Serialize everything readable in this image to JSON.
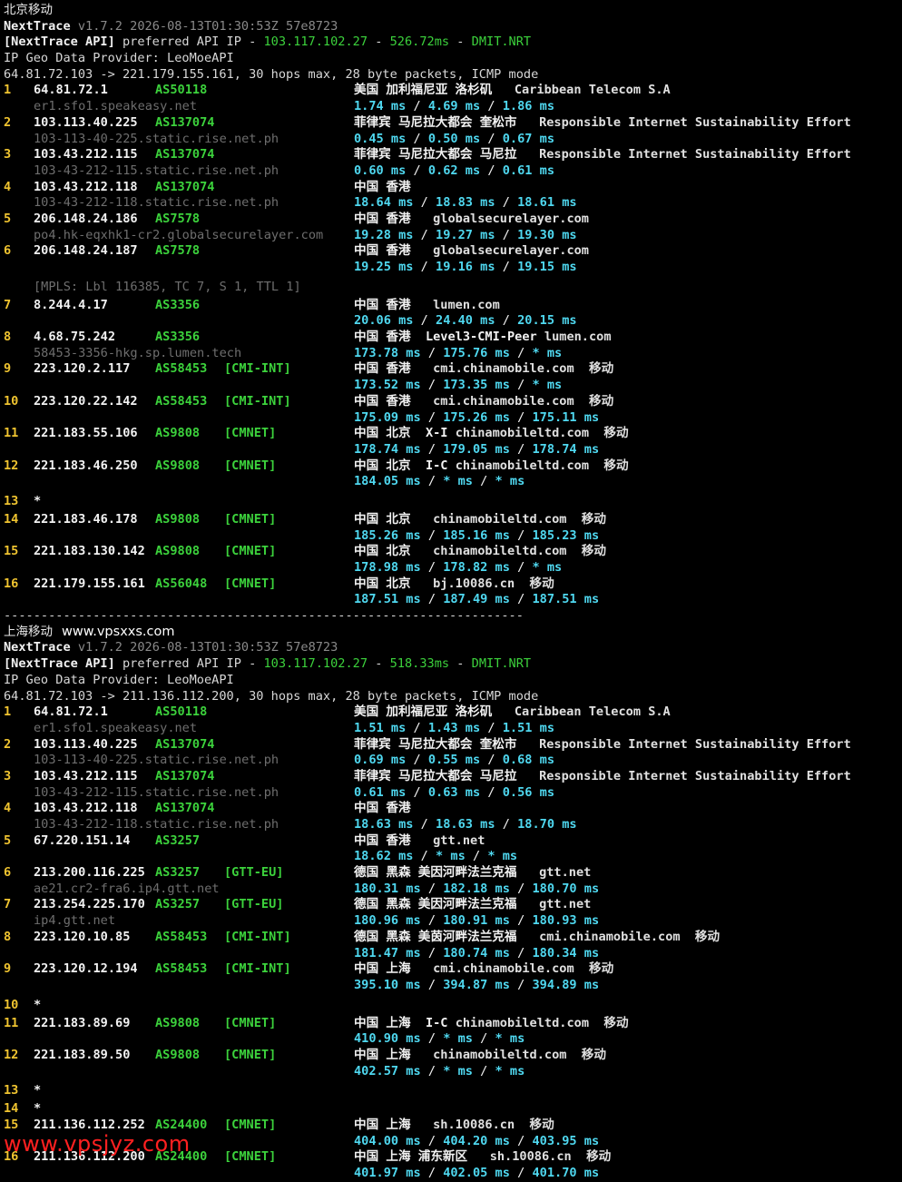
{
  "watermark": "www.vpsjyz.com",
  "separator": "----------------------------------------------------------------------",
  "sections": [
    {
      "title": "北京移动",
      "site": "",
      "brand": "NextTrace",
      "version": " v1.7.2 2026-08-13T01:30:53Z 57e8723",
      "api_prefix": "[NextTrace API]",
      "api_text": " preferred API IP - ",
      "api_ip": "103.117.102.27",
      "api_sep": " - ",
      "api_latency": "526.72ms",
      "api_sep2": " - ",
      "api_node": "DMIT.NRT",
      "geo_provider": "IP Geo Data Provider: LeoMoeAPI",
      "trace_header": "64.81.72.103 -> 221.179.155.161, 30 hops max, 28 byte packets, ICMP mode",
      "hops": [
        {
          "n": "1",
          "ip": "64.81.72.1",
          "as": "AS50118",
          "tag": "",
          "geo": "美国 加利福尼亚 洛杉矶",
          "tag2": "",
          "org": "Caribbean Telecom S.A",
          "host": "er1.sfo1.speakeasy.net",
          "rtt": [
            "1.74 ms",
            "4.69 ms",
            "1.86 ms"
          ]
        },
        {
          "n": "2",
          "ip": "103.113.40.225",
          "as": "AS137074",
          "tag": "",
          "geo": "菲律宾 马尼拉大都会 奎松市",
          "tag2": "",
          "org": "Responsible Internet Sustainability Effort",
          "host": "103-113-40-225.static.rise.net.ph",
          "rtt": [
            "0.45 ms",
            "0.50 ms",
            "0.67 ms"
          ]
        },
        {
          "n": "3",
          "ip": "103.43.212.115",
          "as": "AS137074",
          "tag": "",
          "geo": "菲律宾 马尼拉大都会 马尼拉",
          "tag2": "",
          "org": "Responsible Internet Sustainability Effort",
          "host": "103-43-212-115.static.rise.net.ph",
          "rtt": [
            "0.60 ms",
            "0.62 ms",
            "0.61 ms"
          ]
        },
        {
          "n": "4",
          "ip": "103.43.212.118",
          "as": "AS137074",
          "tag": "",
          "geo": "中国 香港",
          "tag2": "",
          "org": "",
          "host": "103-43-212-118.static.rise.net.ph",
          "rtt": [
            "18.64 ms",
            "18.83 ms",
            "18.61 ms"
          ]
        },
        {
          "n": "5",
          "ip": "206.148.24.186",
          "as": "AS7578",
          "tag": "",
          "geo": "中国 香港",
          "tag2": "",
          "org": "globalsecurelayer.com",
          "host": "po4.hk-eqxhk1-cr2.globalsecurelayer.com",
          "rtt": [
            "19.28 ms",
            "19.27 ms",
            "19.30 ms"
          ]
        },
        {
          "n": "6",
          "ip": "206.148.24.187",
          "as": "AS7578",
          "tag": "",
          "geo": "中国 香港",
          "tag2": "",
          "org": "globalsecurelayer.com",
          "host": "",
          "rtt": [
            "19.25 ms",
            "19.16 ms",
            "19.15 ms"
          ],
          "mpls": "[MPLS: Lbl 116385, TC 7, S 1, TTL 1]"
        },
        {
          "n": "7",
          "ip": "8.244.4.17",
          "as": "AS3356",
          "tag": "",
          "geo": "中国 香港",
          "tag2": "",
          "org": "lumen.com",
          "host": "",
          "rtt": [
            "20.06 ms",
            "24.40 ms",
            "20.15 ms"
          ]
        },
        {
          "n": "8",
          "ip": "4.68.75.242",
          "as": "AS3356",
          "tag": "",
          "geo": "中国 香港",
          "tag2": "Level3-CMI-Peer",
          "org": "lumen.com",
          "host": "58453-3356-hkg.sp.lumen.tech",
          "rtt": [
            "173.78 ms",
            "175.76 ms",
            "* ms"
          ]
        },
        {
          "n": "9",
          "ip": "223.120.2.117",
          "as": "AS58453",
          "tag": "[CMI-INT]",
          "geo": "中国 香港",
          "tag2": "",
          "org": "cmi.chinamobile.com  移动",
          "host": "",
          "rtt": [
            "173.52 ms",
            "173.35 ms",
            "* ms"
          ]
        },
        {
          "n": "10",
          "ip": "223.120.22.142",
          "as": "AS58453",
          "tag": "[CMI-INT]",
          "geo": "中国 香港",
          "tag2": "",
          "org": "cmi.chinamobile.com  移动",
          "host": "",
          "rtt": [
            "175.09 ms",
            "175.26 ms",
            "175.11 ms"
          ]
        },
        {
          "n": "11",
          "ip": "221.183.55.106",
          "as": "AS9808",
          "tag": "[CMNET]",
          "geo": "中国 北京",
          "tag2": "X-I",
          "org": "chinamobileltd.com  移动",
          "host": "",
          "rtt": [
            "178.74 ms",
            "179.05 ms",
            "178.74 ms"
          ]
        },
        {
          "n": "12",
          "ip": "221.183.46.250",
          "as": "AS9808",
          "tag": "[CMNET]",
          "geo": "中国 北京",
          "tag2": "I-C",
          "org": "chinamobileltd.com  移动",
          "host": "",
          "rtt": [
            "184.05 ms",
            "* ms",
            "* ms"
          ]
        },
        {
          "n": "13",
          "ip": "*",
          "timeout": true
        },
        {
          "n": "14",
          "ip": "221.183.46.178",
          "as": "AS9808",
          "tag": "[CMNET]",
          "geo": "中国 北京",
          "tag2": "",
          "org": "chinamobileltd.com  移动",
          "host": "",
          "rtt": [
            "185.26 ms",
            "185.16 ms",
            "185.23 ms"
          ]
        },
        {
          "n": "15",
          "ip": "221.183.130.142",
          "as": "AS9808",
          "tag": "[CMNET]",
          "geo": "中国 北京",
          "tag2": "",
          "org": "chinamobileltd.com  移动",
          "host": "",
          "rtt": [
            "178.98 ms",
            "178.82 ms",
            "* ms"
          ]
        },
        {
          "n": "16",
          "ip": "221.179.155.161",
          "as": "AS56048",
          "tag": "[CMNET]",
          "geo": "中国 北京",
          "tag2": "",
          "org": "bj.10086.cn  移动",
          "host": "",
          "rtt": [
            "187.51 ms",
            "187.49 ms",
            "187.51 ms"
          ]
        }
      ]
    },
    {
      "title": "上海移动",
      "site": "www.vpsxxs.com",
      "brand": "NextTrace",
      "version": " v1.7.2 2026-08-13T01:30:53Z 57e8723",
      "api_prefix": "[NextTrace API]",
      "api_text": " preferred API IP - ",
      "api_ip": "103.117.102.27",
      "api_sep": " - ",
      "api_latency": "518.33ms",
      "api_sep2": " - ",
      "api_node": "DMIT.NRT",
      "geo_provider": "IP Geo Data Provider: LeoMoeAPI",
      "trace_header": "64.81.72.103 -> 211.136.112.200, 30 hops max, 28 byte packets, ICMP mode",
      "hops": [
        {
          "n": "1",
          "ip": "64.81.72.1",
          "as": "AS50118",
          "tag": "",
          "geo": "美国 加利福尼亚 洛杉矶",
          "tag2": "",
          "org": "Caribbean Telecom S.A",
          "host": "er1.sfo1.speakeasy.net",
          "rtt": [
            "1.51 ms",
            "1.43 ms",
            "1.51 ms"
          ]
        },
        {
          "n": "2",
          "ip": "103.113.40.225",
          "as": "AS137074",
          "tag": "",
          "geo": "菲律宾 马尼拉大都会 奎松市",
          "tag2": "",
          "org": "Responsible Internet Sustainability Effort",
          "host": "103-113-40-225.static.rise.net.ph",
          "rtt": [
            "0.69 ms",
            "0.55 ms",
            "0.68 ms"
          ]
        },
        {
          "n": "3",
          "ip": "103.43.212.115",
          "as": "AS137074",
          "tag": "",
          "geo": "菲律宾 马尼拉大都会 马尼拉",
          "tag2": "",
          "org": "Responsible Internet Sustainability Effort",
          "host": "103-43-212-115.static.rise.net.ph",
          "rtt": [
            "0.61 ms",
            "0.63 ms",
            "0.56 ms"
          ]
        },
        {
          "n": "4",
          "ip": "103.43.212.118",
          "as": "AS137074",
          "tag": "",
          "geo": "中国 香港",
          "tag2": "",
          "org": "",
          "host": "103-43-212-118.static.rise.net.ph",
          "rtt": [
            "18.63 ms",
            "18.63 ms",
            "18.70 ms"
          ]
        },
        {
          "n": "5",
          "ip": "67.220.151.14",
          "as": "AS3257",
          "tag": "",
          "geo": "中国 香港",
          "tag2": "",
          "org": "gtt.net",
          "host": "",
          "rtt": [
            "18.62 ms",
            "* ms",
            "* ms"
          ]
        },
        {
          "n": "6",
          "ip": "213.200.116.225",
          "as": "AS3257",
          "tag": "[GTT-EU]",
          "geo": "德国 黑森 美因河畔法兰克福",
          "tag2": "",
          "org": "gtt.net",
          "host": "ae21.cr2-fra6.ip4.gtt.net",
          "rtt": [
            "180.31 ms",
            "182.18 ms",
            "180.70 ms"
          ]
        },
        {
          "n": "7",
          "ip": "213.254.225.170",
          "as": "AS3257",
          "tag": "[GTT-EU]",
          "geo": "德国 黑森 美因河畔法兰克福",
          "tag2": "",
          "org": "gtt.net",
          "host": "ip4.gtt.net",
          "rtt": [
            "180.96 ms",
            "180.91 ms",
            "180.93 ms"
          ]
        },
        {
          "n": "8",
          "ip": "223.120.10.85",
          "as": "AS58453",
          "tag": "[CMI-INT]",
          "geo": "德国 黑森 美茵河畔法兰克福",
          "tag2": "",
          "org": "cmi.chinamobile.com  移动",
          "host": "",
          "rtt": [
            "181.47 ms",
            "180.74 ms",
            "180.34 ms"
          ]
        },
        {
          "n": "9",
          "ip": "223.120.12.194",
          "as": "AS58453",
          "tag": "[CMI-INT]",
          "geo": "中国 上海",
          "tag2": "",
          "org": "cmi.chinamobile.com  移动",
          "host": "",
          "rtt": [
            "395.10 ms",
            "394.87 ms",
            "394.89 ms"
          ]
        },
        {
          "n": "10",
          "ip": "*",
          "timeout": true
        },
        {
          "n": "11",
          "ip": "221.183.89.69",
          "as": "AS9808",
          "tag": "[CMNET]",
          "geo": "中国 上海",
          "tag2": "I-C",
          "org": "chinamobileltd.com  移动",
          "host": "",
          "rtt": [
            "410.90 ms",
            "* ms",
            "* ms"
          ]
        },
        {
          "n": "12",
          "ip": "221.183.89.50",
          "as": "AS9808",
          "tag": "[CMNET]",
          "geo": "中国 上海",
          "tag2": "",
          "org": "chinamobileltd.com  移动",
          "host": "",
          "rtt": [
            "402.57 ms",
            "* ms",
            "* ms"
          ]
        },
        {
          "n": "13",
          "ip": "*",
          "timeout": true
        },
        {
          "n": "14",
          "ip": "*",
          "timeout": true,
          "tight": true
        },
        {
          "n": "15",
          "ip": "211.136.112.252",
          "as": "AS24400",
          "tag": "[CMNET]",
          "geo": "中国 上海",
          "tag2": "",
          "org": "sh.10086.cn  移动",
          "host": "",
          "rtt": [
            "404.00 ms",
            "404.20 ms",
            "403.95 ms"
          ]
        },
        {
          "n": "16",
          "ip": "211.136.112.200",
          "as": "AS24400",
          "tag": "[CMNET]",
          "geo": "中国 上海 浦东新区",
          "tag2": "",
          "org": "sh.10086.cn  移动",
          "host": "",
          "rtt": [
            "401.97 ms",
            "402.05 ms",
            "401.70 ms"
          ]
        }
      ]
    }
  ]
}
